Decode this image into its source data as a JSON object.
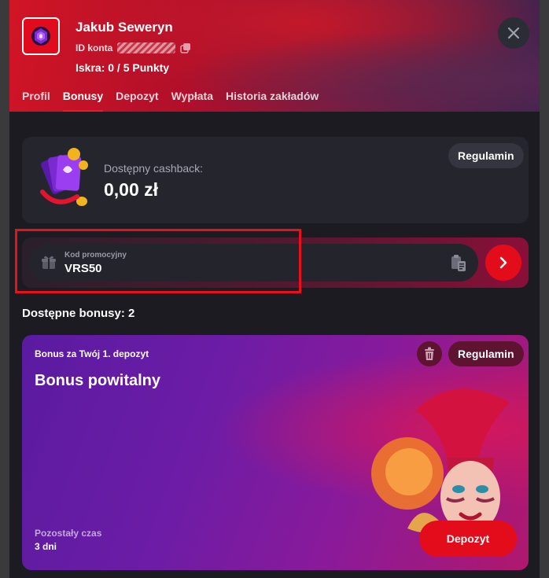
{
  "profile": {
    "username": "Jakub Seweryn",
    "account_id_label": "ID konta",
    "spark_text": "Iskra: 0  / 5 Punkty"
  },
  "tabs": [
    {
      "label": "Profil",
      "active": false
    },
    {
      "label": "Bonusy",
      "active": true
    },
    {
      "label": "Depozyt",
      "active": false
    },
    {
      "label": "Wypłata",
      "active": false
    },
    {
      "label": "Historia zakładów",
      "active": false
    }
  ],
  "cashback": {
    "label": "Dostępny cashback:",
    "value": "0,00 zł",
    "terms_label": "Regulamin"
  },
  "promo": {
    "label": "Kod promocyjny",
    "value": "VRS50"
  },
  "bonuses": {
    "title": "Dostępne bonusy: 2",
    "card": {
      "subtitle": "Bonus za Twój 1. depozyt",
      "title": "Bonus powitalny",
      "terms_label": "Regulamin",
      "time_label": "Pozostały czas",
      "time_value": "3 dni",
      "deposit_label": "Depozyt"
    }
  },
  "icons": {
    "close": "close-icon",
    "copy": "copy-icon",
    "gift": "gift-icon",
    "clipboard": "clipboard-icon",
    "arrow": "chevron-right-icon",
    "trash": "trash-icon"
  },
  "colors": {
    "accent_red": "#e30c1a",
    "panel_bg": "#1b1b21",
    "card_bg": "#25252d",
    "bonus_purple": "#6c1ca6"
  }
}
